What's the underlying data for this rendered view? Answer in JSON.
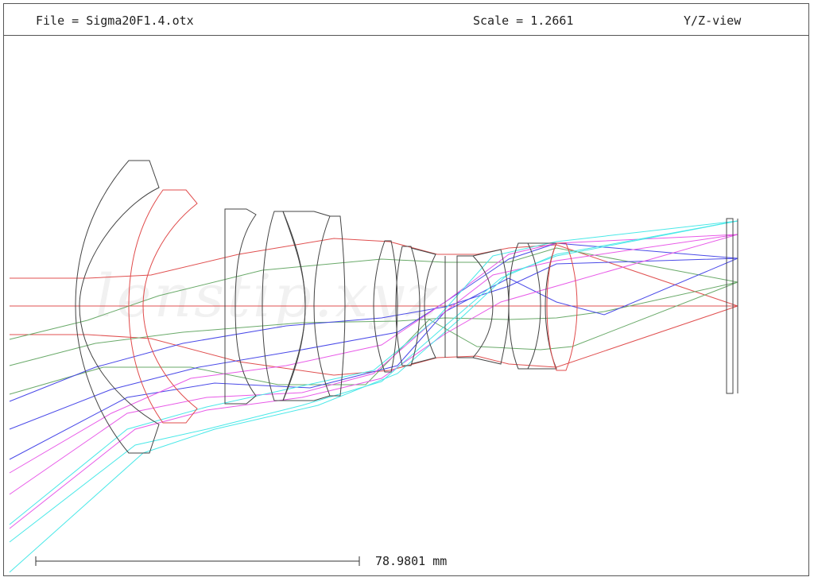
{
  "header": {
    "file": "File = Sigma20F1.4.otx",
    "scale": "Scale = 1.2661",
    "view": "Y/Z-view"
  },
  "scale_bar": {
    "label": "78.9801 mm"
  },
  "watermark": "lenstip.xyz",
  "colors": {
    "frame": "#555555",
    "lens_black": "#444444",
    "lens_red": "#e04b4b",
    "ray_red": "#e05050",
    "ray_green": "#6aaa6a",
    "ray_blue": "#4a4ae8",
    "ray_magenta": "#e85ae8",
    "ray_cyan": "#4ae8e8"
  }
}
